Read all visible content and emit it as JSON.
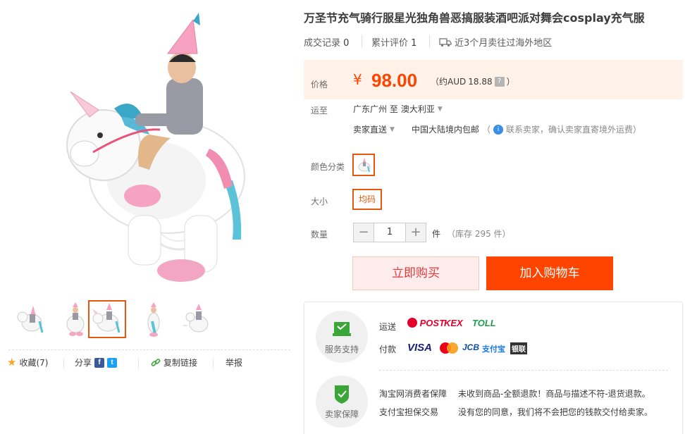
{
  "product": {
    "title": "万圣节充气骑行服星光独角兽恶搞服装酒吧派对舞会cosplay充气服",
    "deal_label": "成交记录",
    "deal_count": "0",
    "review_label": "累计评价",
    "review_count": "1",
    "overseas_text": "近3个月卖往过海外地区"
  },
  "price": {
    "label": "价格",
    "symbol": "¥",
    "value": "98.00",
    "aud_prefix": "（约AUD",
    "aud_value": "18.88",
    "aud_suffix": "）",
    "help": "?"
  },
  "shipping": {
    "label": "运至",
    "from": "广东广州 至",
    "to": "澳大利亚",
    "method": "卖家直送",
    "free_shipping": "中国大陆境内包邮",
    "note": "联系卖家，确认卖家直寄境外运费）",
    "note_open": "（"
  },
  "color": {
    "label": "颜色分类"
  },
  "size": {
    "label": "大小",
    "option": "均码"
  },
  "quantity": {
    "label": "数量",
    "minus": "−",
    "value": "1",
    "plus": "+",
    "unit": "件",
    "stock": "（库存 295 件）"
  },
  "buttons": {
    "buy_now": "立即购买",
    "add_to_cart": "加入购物车"
  },
  "service": {
    "support_label": "服务支持",
    "shipping_label": "运送",
    "payment_label": "付款",
    "shipping_logos": [
      "POST",
      "KEX",
      "TOLL"
    ],
    "payment_logos": [
      "VISA",
      "MasterCard",
      "JCB",
      "支付宝",
      "银联"
    ],
    "guarantee_label": "卖家保障",
    "guarantee_1_name": "淘宝网消费者保障",
    "guarantee_1_text": "未收到商品-全额退款！商品与描述不符-退货退款。",
    "guarantee_2_name": "支付宝担保交易",
    "guarantee_2_text": "没有您的同意，我们将不会把您的钱款交付给卖家。"
  },
  "actions": {
    "favorite": "收藏(7)",
    "share": "分享",
    "copy_link": "复制链接",
    "report": "举报",
    "facebook_glyph": "f",
    "twitter_glyph": "t"
  },
  "colors": {
    "accent": "#ff4400",
    "price": "#ff4400",
    "selected_border": "#e4590f",
    "price_bg": "#fff2e8",
    "support_green": "#3ba638"
  }
}
